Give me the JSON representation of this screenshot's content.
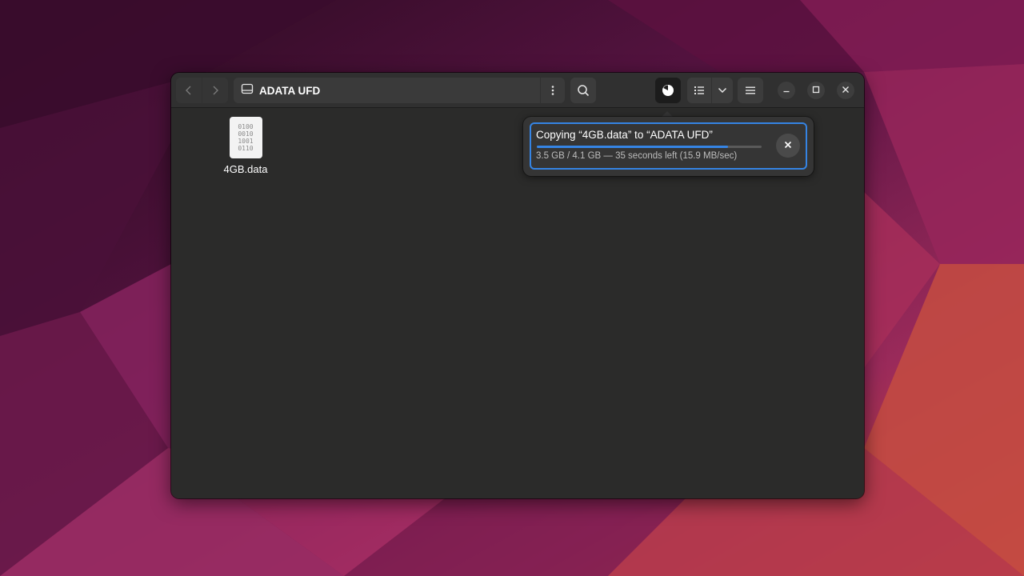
{
  "desktop": {
    "wallpaper_colors": [
      "#3a0f2b",
      "#7c1f5a",
      "#b8345e",
      "#d9553c"
    ]
  },
  "window": {
    "location": "ADATA UFD",
    "icons": {
      "back": "chevron-left-icon",
      "forward": "chevron-right-icon",
      "drive": "drive-icon",
      "path_menu": "vertical-dots-icon",
      "search": "search-icon",
      "operations": "progress-pie-icon",
      "view": "list-view-icon",
      "view_options": "chevron-down-icon",
      "menu": "hamburger-menu-icon",
      "minimize": "minimize-icon",
      "maximize": "maximize-icon",
      "close": "close-icon"
    }
  },
  "files": [
    {
      "name": "4GB.data",
      "icon": "binary-file-icon",
      "icon_text": "0100\n0010\n1001\n0110"
    }
  ],
  "operation": {
    "title": "Copying “4GB.data” to “ADATA UFD”",
    "detail": "3.5 GB / 4.1 GB — 35 seconds left (15.9 MB/sec)",
    "progress": 0.85,
    "accent": "#3584e4",
    "cancel_icon": "close-icon"
  }
}
